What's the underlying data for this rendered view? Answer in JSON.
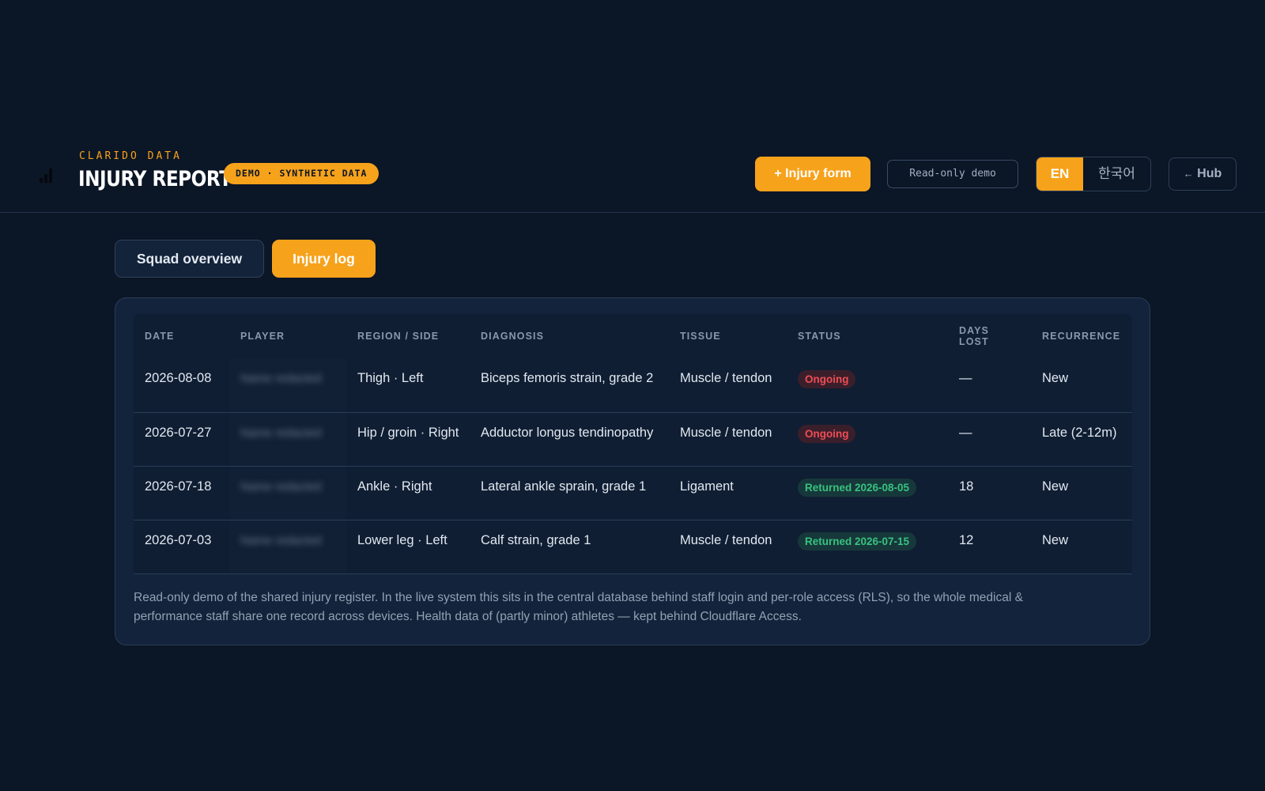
{
  "header": {
    "eyebrow": "CLARIDO DATA",
    "title": "INJURY REPORT",
    "badge": "DEMO · SYNTHETIC DATA",
    "injury_form_label": "+ Injury form",
    "readonly_label": "Read-only demo",
    "lang_en": "EN",
    "lang_ko": "한국어",
    "hub_label": "Hub",
    "hub_arrow": "←",
    "logo_icon": "bar-chart-icon"
  },
  "tabs": [
    {
      "label": "Squad overview",
      "active": false
    },
    {
      "label": "Injury log",
      "active": true
    }
  ],
  "table": {
    "columns": [
      "DATE",
      "PLAYER",
      "REGION / SIDE",
      "DIAGNOSIS",
      "TISSUE",
      "STATUS",
      "DAYS LOST",
      "RECURRENCE"
    ],
    "rows": [
      {
        "date": "2026-08-08",
        "player": "Name redacted",
        "region": "Thigh · Left",
        "diagnosis": "Biceps femoris strain, grade 2",
        "tissue": "Muscle / tendon",
        "status": "Ongoing",
        "status_type": "ongoing",
        "days_lost": "—",
        "recurrence": "New"
      },
      {
        "date": "2026-07-27",
        "player": "Name redacted",
        "region": "Hip / groin · Right",
        "diagnosis": "Adductor longus tendinopathy",
        "tissue": "Muscle / tendon",
        "status": "Ongoing",
        "status_type": "ongoing",
        "days_lost": "—",
        "recurrence": "Late (2-12m)"
      },
      {
        "date": "2026-07-18",
        "player": "Name redacted",
        "region": "Ankle · Right",
        "diagnosis": "Lateral ankle sprain, grade 1",
        "tissue": "Ligament",
        "status": "Returned 2026-08-05",
        "status_type": "returned",
        "days_lost": "18",
        "recurrence": "New"
      },
      {
        "date": "2026-07-03",
        "player": "Name redacted",
        "region": "Lower leg · Left",
        "diagnosis": "Calf strain, grade 1",
        "tissue": "Muscle / tendon",
        "status": "Returned 2026-07-15",
        "status_type": "returned",
        "days_lost": "12",
        "recurrence": "New"
      }
    ]
  },
  "footnote": "Read-only demo of the shared injury register. In the live system this sits in the central database behind staff login and per-role access (RLS), so the whole medical & performance staff share one record across devices. Health data of (partly minor) athletes — kept behind Cloudflare Access.",
  "colors": {
    "background": "#0b1626",
    "accent": "#f7a21b",
    "ongoing": "#ef4d55",
    "returned": "#37c27f"
  }
}
